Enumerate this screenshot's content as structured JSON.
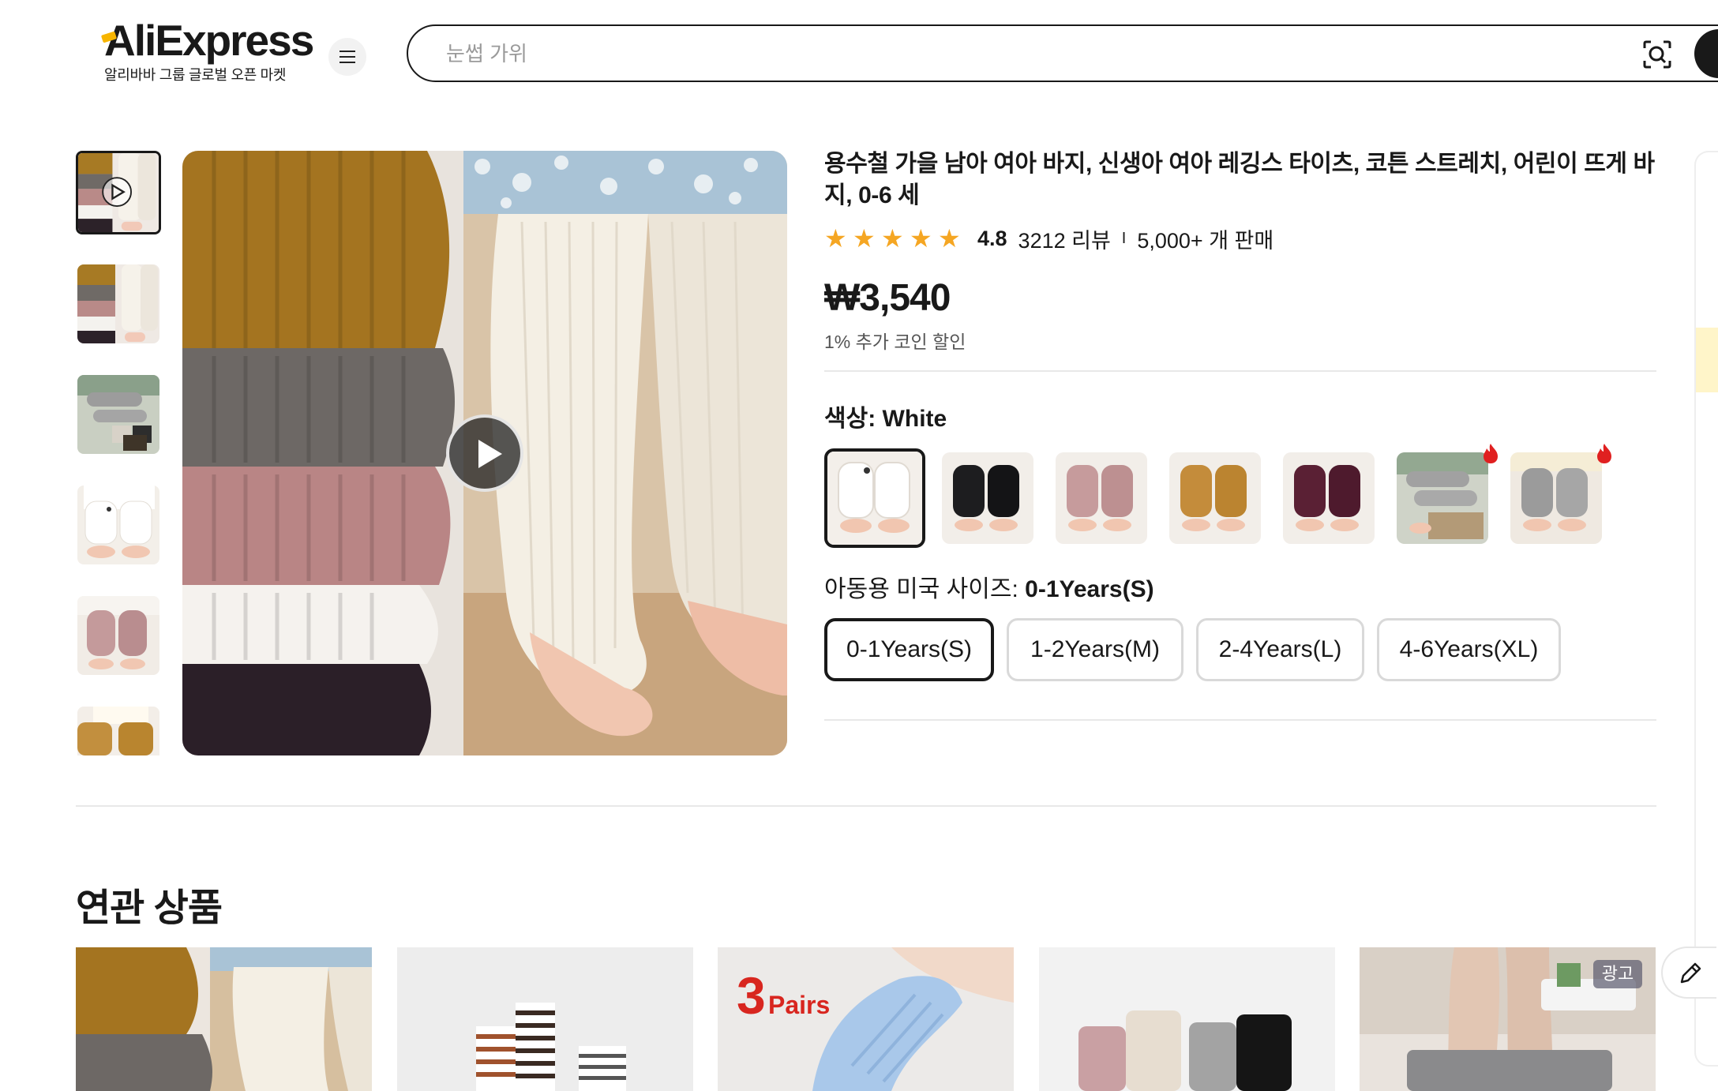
{
  "header": {
    "logo_text": "AliExpress",
    "logo_tagline": "알리바바 그룹 글로벌 오픈 마켓",
    "search_placeholder": "눈썹 가위"
  },
  "product": {
    "title": "용수철 가을 남아 여아 바지, 신생아 여아 레깅스 타이츠, 코튼 스트레치, 어린이 뜨게 바지, 0-6 세",
    "rating": "4.8",
    "stars": 5,
    "reviews": "3212 리뷰",
    "separator": "I",
    "sold": "5,000+ 개 판매",
    "price": "₩3,540",
    "coin_discount": "1% 추가 코인 할인",
    "color_label": "색상:",
    "color_value": "White",
    "colors": [
      "White",
      "Black",
      "Pink",
      "Ginger",
      "Wine",
      "Grey Print",
      "Grey"
    ],
    "size_label": "아동용 미국 사이즈:",
    "size_value": "0-1Years(S)",
    "sizes": [
      "0-1Years(S)",
      "1-2Years(M)",
      "2-4Years(L)",
      "4-6Years(XL)"
    ]
  },
  "related": {
    "title": "연관 상품",
    "ad_label": "광고",
    "promo_text_number": "3",
    "promo_text_word": "Pairs"
  },
  "colors": {
    "accent_star": "#f5a623",
    "text": "#191919",
    "border": "#d9d9d9"
  }
}
